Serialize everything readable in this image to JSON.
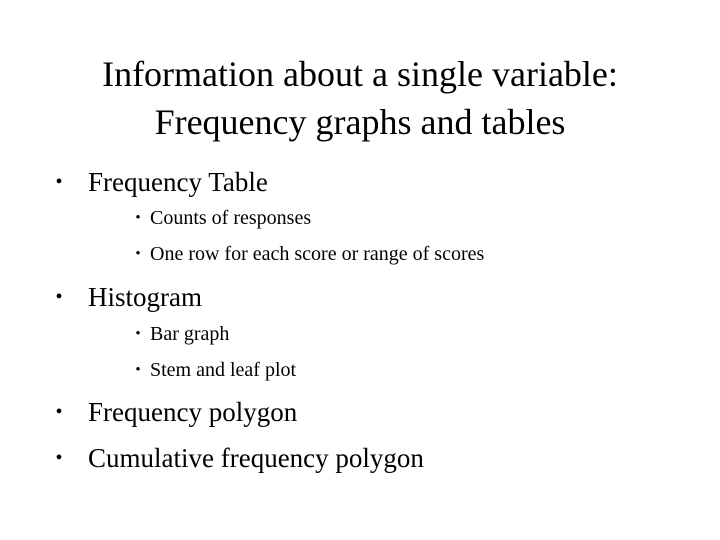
{
  "slide": {
    "title_lines": [
      "Information about a single variable:",
      "Frequency graphs and tables"
    ],
    "bullet_glyph": "•",
    "items": [
      {
        "label": "Frequency Table",
        "children": [
          "Counts of responses",
          "One row for each score or range of scores"
        ]
      },
      {
        "label": "Histogram",
        "children": [
          "Bar graph",
          "Stem and leaf plot"
        ]
      },
      {
        "label": "Frequency polygon",
        "children": []
      },
      {
        "label": "Cumulative frequency polygon",
        "children": []
      }
    ]
  }
}
